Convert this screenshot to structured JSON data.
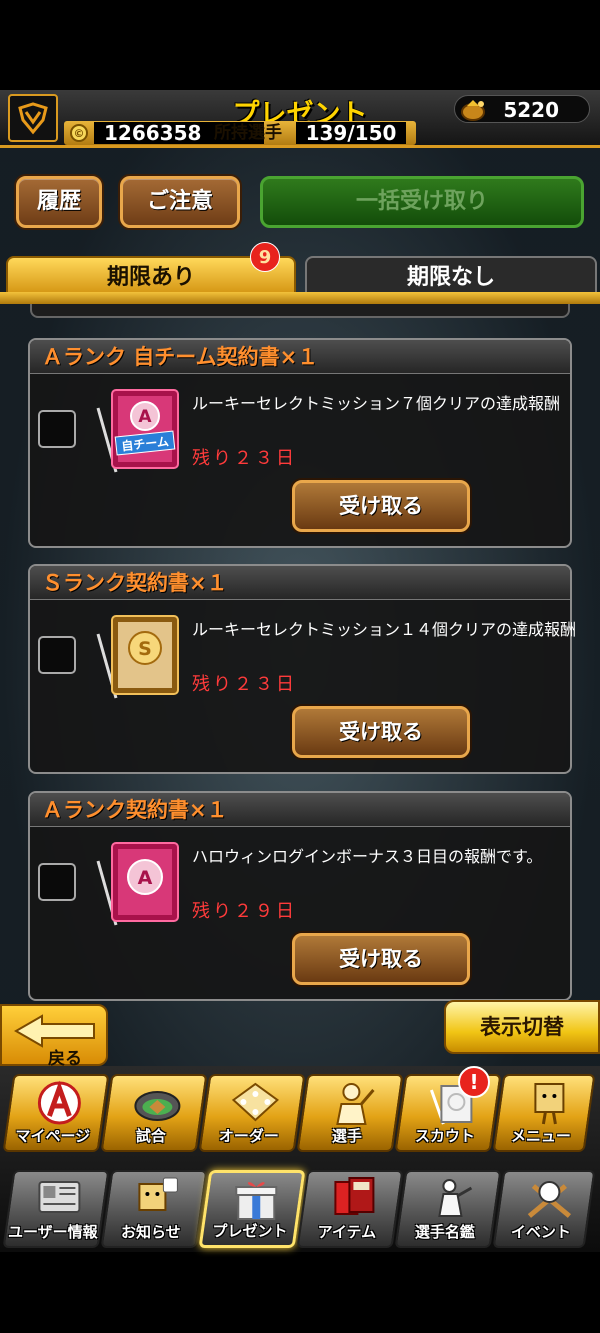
{
  "header": {
    "title": "プレゼント",
    "coins": "1266358",
    "roster_label": "所持選手",
    "roster_value": "139/150",
    "gems": "5220"
  },
  "actions": {
    "history": "履歴",
    "notice": "ご注意",
    "receive_all": "一括受け取り"
  },
  "tabs": {
    "with_limit": "期限あり",
    "with_limit_badge": "9",
    "no_limit": "期限なし"
  },
  "presents": [
    {
      "title": "Ａランク 自チーム契約書×１",
      "description": "ルーキーセレクトミッション７個クリアの達成報酬",
      "expiry": "残り２３日",
      "button": "受け取る",
      "icon": "contract-a-own-team-icon",
      "icon_letter": "A",
      "icon_text": "自チーム"
    },
    {
      "title": "Ｓランク契約書×１",
      "description": "ルーキーセレクトミッション１４個クリアの達成報酬",
      "expiry": "残り２３日",
      "button": "受け取る",
      "icon": "contract-s-icon",
      "icon_letter": "S",
      "icon_text": ""
    },
    {
      "title": "Ａランク契約書×１",
      "description": "ハロウィンログインボーナス３日目の報酬です。",
      "expiry": "残り２９日",
      "button": "受け取る",
      "icon": "contract-a-icon",
      "icon_letter": "A",
      "icon_text": ""
    }
  ],
  "bottom": {
    "back": "戻る",
    "toggle": "表示切替"
  },
  "nav_row1": [
    {
      "label": "マイページ",
      "icon": "mypage-icon"
    },
    {
      "label": "試合",
      "icon": "stadium-icon"
    },
    {
      "label": "オーダー",
      "icon": "order-icon"
    },
    {
      "label": "選手",
      "icon": "player-icon"
    },
    {
      "label": "スカウト",
      "icon": "scout-icon"
    },
    {
      "label": "メニュー",
      "icon": "menu-icon"
    }
  ],
  "nav_row2": [
    {
      "label": "ユーザー情報",
      "icon": "user-info-icon"
    },
    {
      "label": "お知らせ",
      "icon": "notice-icon"
    },
    {
      "label": "プレゼント",
      "icon": "present-icon"
    },
    {
      "label": "アイテム",
      "icon": "item-icon"
    },
    {
      "label": "選手名鑑",
      "icon": "player-book-icon"
    },
    {
      "label": "イベント",
      "icon": "event-icon"
    }
  ],
  "scout_alert": "!",
  "colors": {
    "accent_gold": "#d99a20",
    "title_yellow": "#ffd400",
    "card_title": "#ff8f2e",
    "expiry_red": "#ff3b3b",
    "badge_red": "#e8231d"
  }
}
